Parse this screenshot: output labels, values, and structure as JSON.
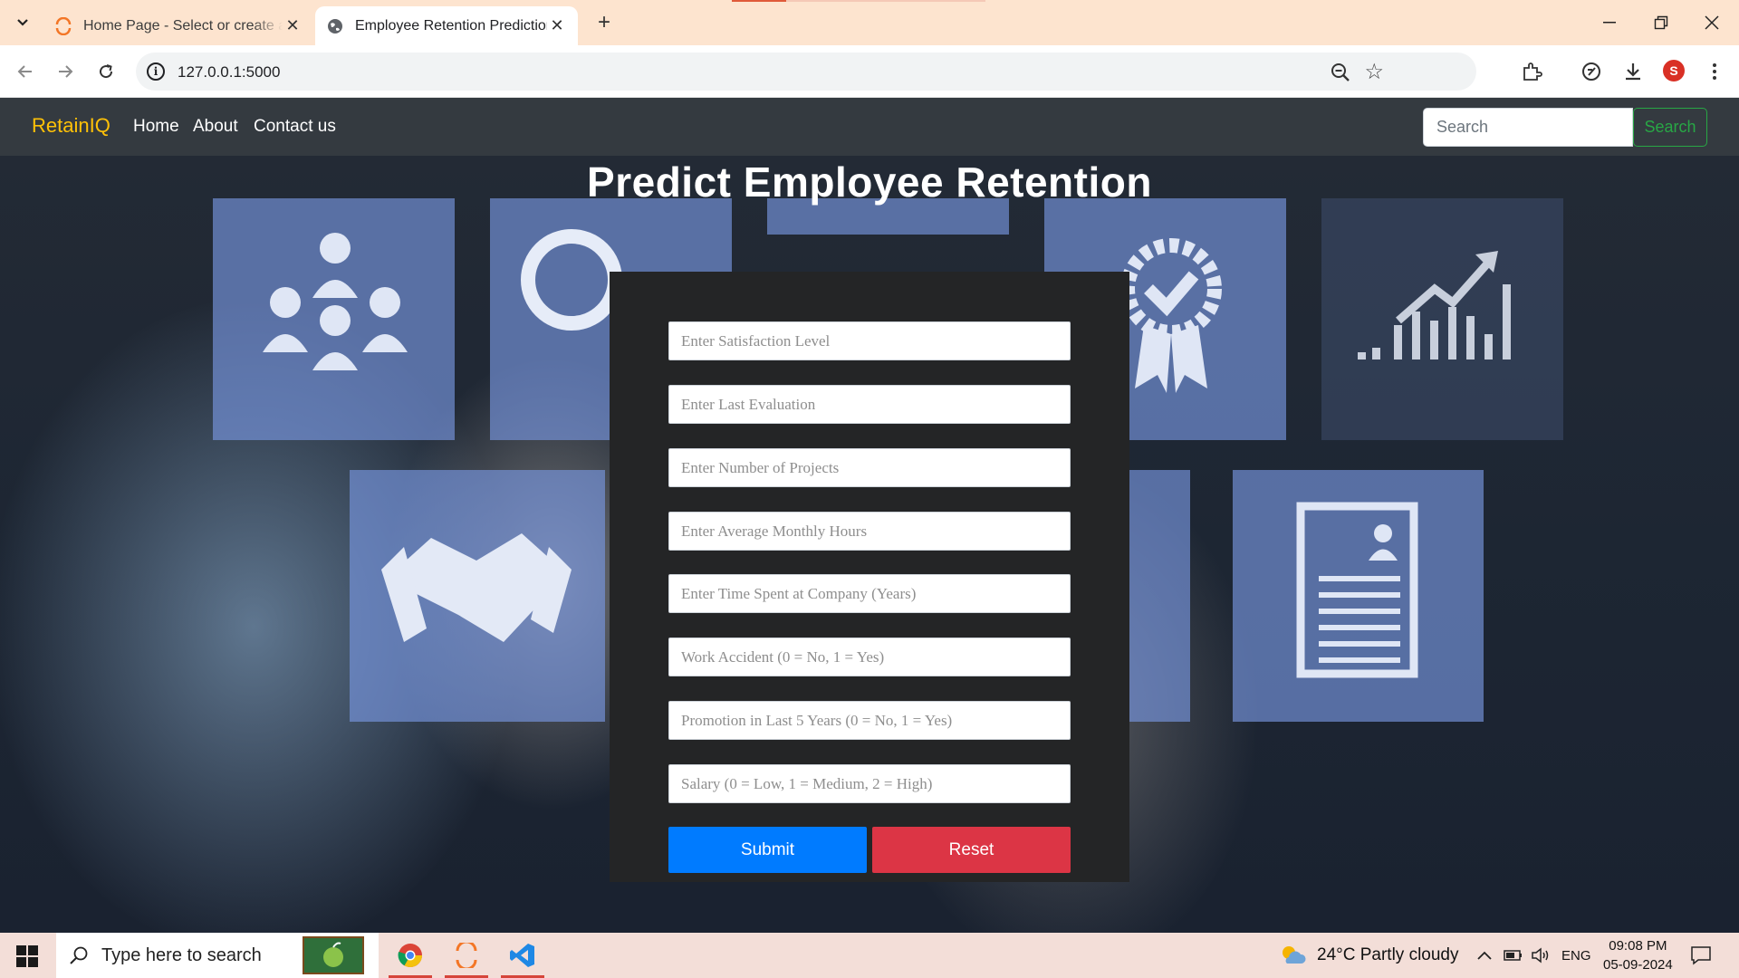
{
  "browser": {
    "tabs": [
      {
        "title": "Home Page - Select or create a notebook",
        "active": false,
        "favicon": "jupyter-loading-icon"
      },
      {
        "title": "Employee Retention Prediction",
        "active": true,
        "favicon": "globe-icon"
      }
    ],
    "url": "127.0.0.1:5000",
    "profile_initial": "S"
  },
  "navbar": {
    "brand": "RetainIQ",
    "links": [
      "Home",
      "About",
      "Contact us"
    ],
    "search_placeholder": "Search",
    "search_button": "Search"
  },
  "main": {
    "title": "Predict Employee Retention",
    "fields": [
      "Enter Satisfaction Level",
      "Enter Last Evaluation",
      "Enter Number of Projects",
      "Enter Average Monthly Hours",
      "Enter Time Spent at Company (Years)",
      "Work Accident (0 = No, 1 = Yes)",
      "Promotion in Last 5 Years (0 = No, 1 = Yes)",
      "Salary (0 = Low, 1 = Medium, 2 = High)"
    ],
    "submit_label": "Submit",
    "reset_label": "Reset"
  },
  "taskbar": {
    "search_placeholder": "Type here to search",
    "weather": "24°C  Partly cloudy",
    "language": "ENG",
    "time": "09:08 PM",
    "date": "05-09-2024"
  },
  "colors": {
    "brand": "#ffc107",
    "navbar_bg": "#343a40",
    "submit": "#007bff",
    "reset": "#dc3545",
    "search_outline": "#28a745"
  }
}
